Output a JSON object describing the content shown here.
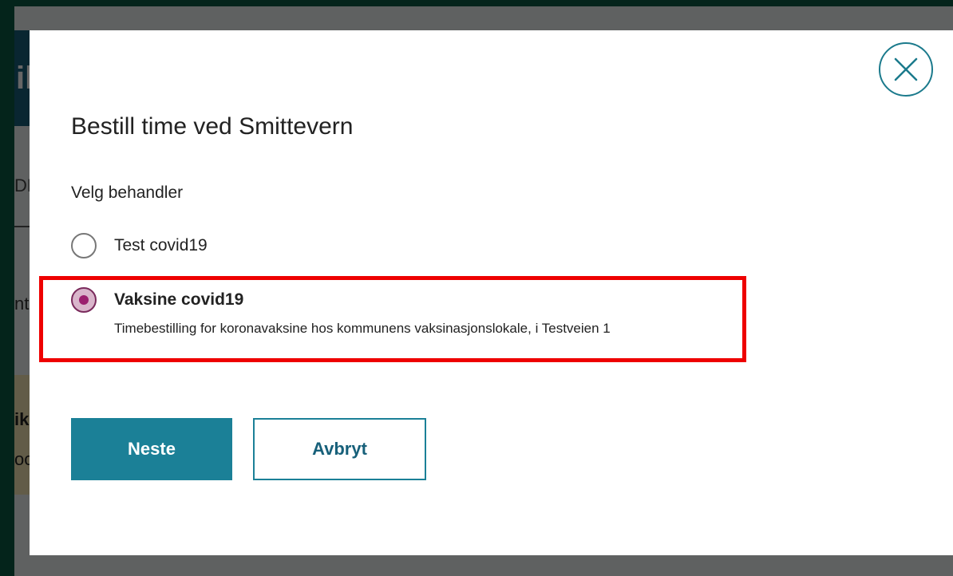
{
  "background": {
    "header_fragment": "il",
    "tab_fragment": "DE",
    "label_fragment": "nti",
    "yellow_fragment_1": "ik",
    "yellow_fragment_2": "oc"
  },
  "modal": {
    "title": "Bestill time ved Smittevern",
    "group_label": "Velg behandler",
    "options": [
      {
        "label": "Test covid19",
        "description": "",
        "selected": false
      },
      {
        "label": "Vaksine covid19",
        "description": "Timebestilling for koronavaksine hos kommunens vaksinasjonslokale, i Testveien 1",
        "selected": true
      }
    ],
    "next_label": "Neste",
    "cancel_label": "Avbryt",
    "close_icon": "close-icon"
  },
  "colors": {
    "accent": "#1b8097",
    "radio_selected": "#9b1f6e",
    "highlight": "#ee0000",
    "frame": "#0a5a45"
  }
}
